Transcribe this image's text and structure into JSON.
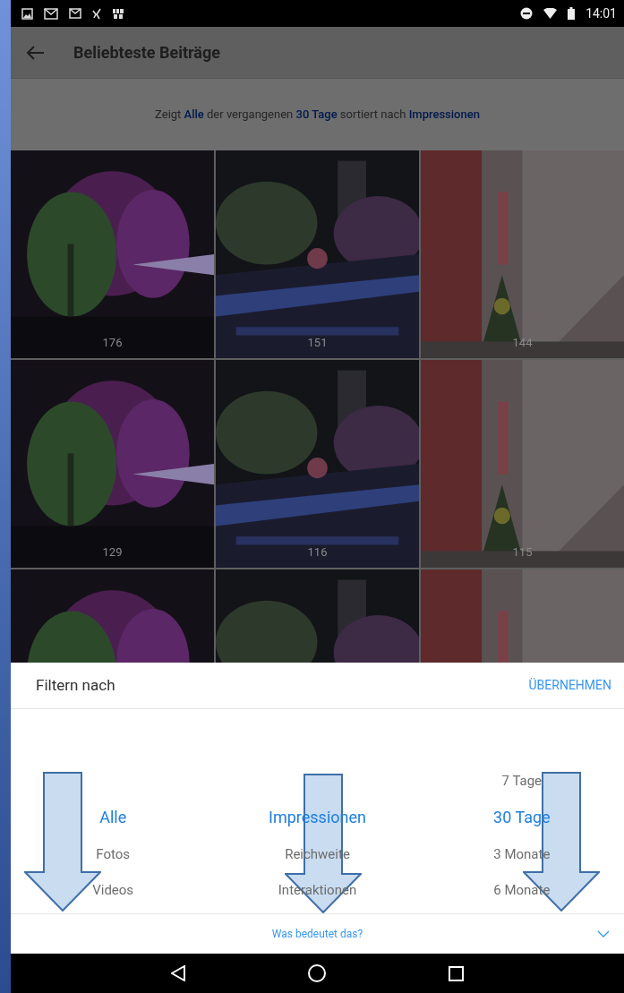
{
  "status_bar": {
    "time": "14:01"
  },
  "header": {
    "title": "Beliebteste Beiträge"
  },
  "subtitle": [
    {
      "text": "Zeigt ",
      "highlight": false
    },
    {
      "text": "Alle",
      "highlight": true
    },
    {
      "text": " der vergangenen ",
      "highlight": false
    },
    {
      "text": "30 Tage",
      "highlight": true
    },
    {
      "text": " sortiert nach ",
      "highlight": false
    },
    {
      "text": "Impressionen",
      "highlight": true
    }
  ],
  "tiles": [
    {
      "kind": "picture",
      "count": "176"
    },
    {
      "kind": "picture",
      "count": "151"
    },
    {
      "kind": "picture",
      "count": "144"
    },
    {
      "kind": "picture",
      "count": "129"
    },
    {
      "kind": "picture",
      "count": "116"
    },
    {
      "kind": "picture",
      "count": "115"
    },
    {
      "kind": "picture"
    },
    {
      "kind": "picture"
    },
    {
      "kind": "picture"
    }
  ],
  "filter_sheet": {
    "title": "Filtern nach",
    "apply": "ÜBERNEHMEN",
    "columns": [
      [
        {
          "label": "Alle",
          "selected": true
        },
        {
          "label": "Fotos",
          "selected": false
        },
        {
          "label": "Videos",
          "selected": false
        }
      ],
      [
        {
          "label": "Impressionen",
          "selected": true
        },
        {
          "label": "Reichweite",
          "selected": false
        },
        {
          "label": "Interaktionen",
          "selected": false
        }
      ],
      [
        {
          "label": "7 Tage",
          "selected": false
        },
        {
          "label": "30 Tage",
          "selected": true
        },
        {
          "label": "3 Monate",
          "selected": false
        },
        {
          "label": "6 Monate",
          "selected": false
        }
      ]
    ],
    "help_link": "Was bedeutet das?"
  }
}
